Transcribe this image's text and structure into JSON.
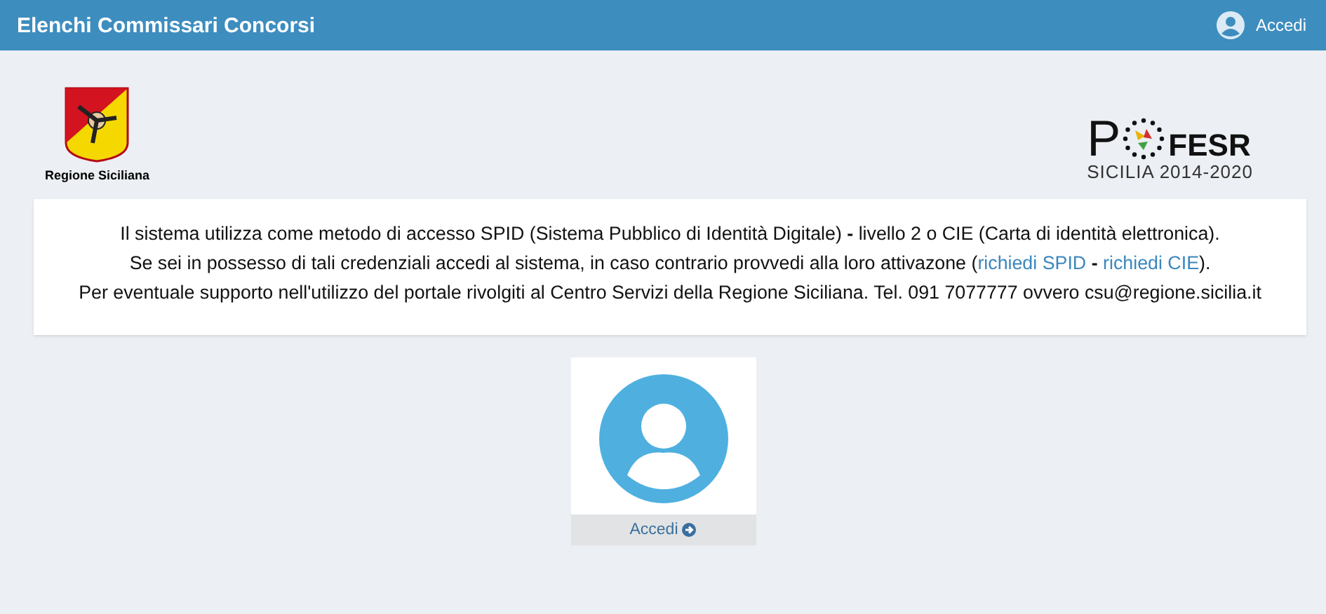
{
  "header": {
    "title": "Elenchi Commissari Concorsi",
    "login_label": "Accedi"
  },
  "logos": {
    "left_caption": "Regione Siciliana",
    "right_letter": "P",
    "right_brand": "FESR",
    "right_caption": "SICILIA 2014-2020"
  },
  "info": {
    "lines": [
      [
        {
          "kind": "text",
          "text": "Il sistema utilizza come metodo di accesso SPID (Sistema Pubblico di Identità Digitale) **-** livello 2 o CIE (Carta di identità elettronica)."
        }
      ],
      [
        {
          "kind": "text",
          "text": "Se sei in possesso di tali credenziali accedi al sistema, in caso contrario provvedi alla loro attivazone ("
        },
        {
          "kind": "link",
          "text": "richiedi SPID"
        },
        {
          "kind": "text",
          "text": " **-** "
        },
        {
          "kind": "link",
          "text": "richiedi CIE"
        },
        {
          "kind": "text",
          "text": ")."
        }
      ],
      [
        {
          "kind": "text",
          "text": "Per eventuale supporto nell'utilizzo del portale rivolgiti al Centro Servizi della Regione Siciliana. Tel. 091 7077777 ovvero csu@regione.sicilia.it"
        }
      ]
    ]
  },
  "login_card": {
    "button_label": "Accedi"
  }
}
